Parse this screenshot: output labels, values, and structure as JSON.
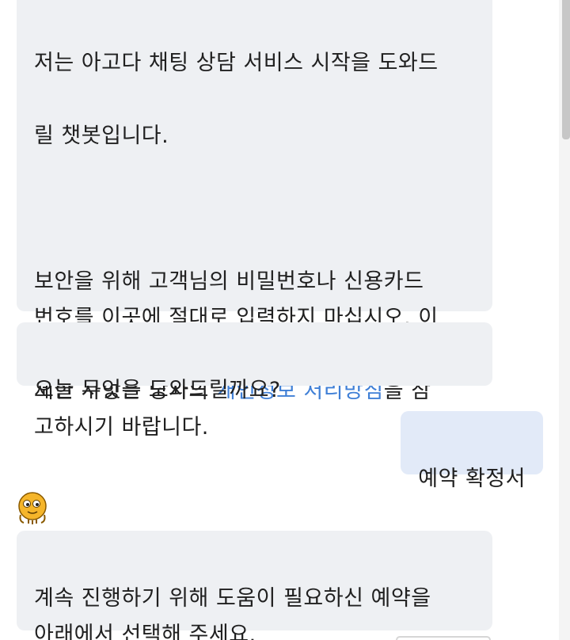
{
  "messages": {
    "intro_line1": "저는 아고다 채팅 상담 서비스 시작을 도와드",
    "intro_line2": "릴 챗봇입니다.",
    "privacy_pre": "보안을 위해 고객님의 비밀번호나 신용카드\n번호를 이곳에 절대로 입력하지 마십시오. 이\n대화 내역에 대한 기록이 보관됩니다. 더 자\n세한 사항은 당사의 ",
    "privacy_link": "개인정보 처리방침",
    "privacy_post": "을 참\n고하시기 바랍니다.",
    "help_question": "오늘 무엇을 도와드릴까요?",
    "user_reply": "예약 확정서",
    "continue_text": "계속 진행하기 위해 도움이 필요하신 예약을\n아래에서 선택해 주세요."
  },
  "colors": {
    "bot_bubble": "#eef0f3",
    "user_bubble": "#e2eaf8",
    "link": "#3f7fd6",
    "avatar": "#f5b52a"
  },
  "icons": {
    "bot_avatar": "chatbot-avatar-icon"
  }
}
